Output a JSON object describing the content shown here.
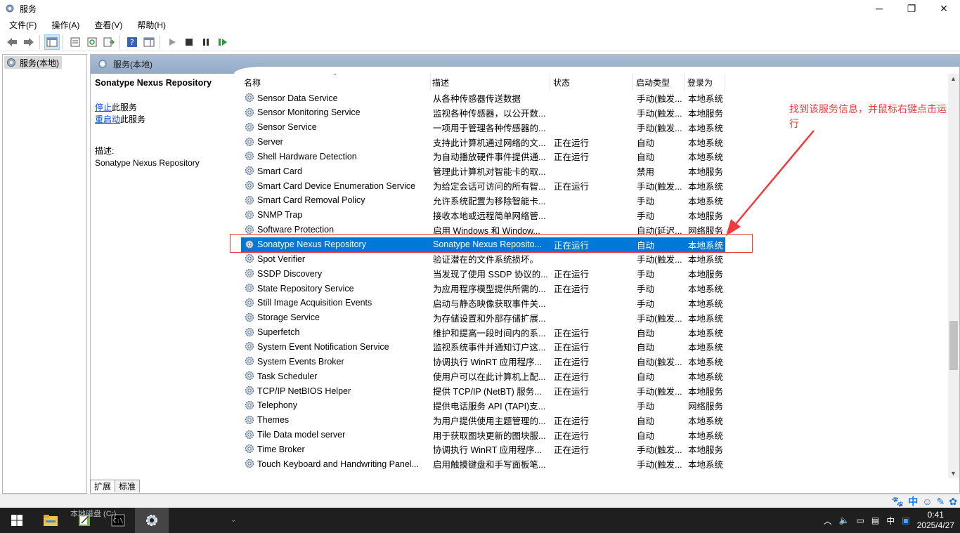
{
  "window": {
    "title": "服务",
    "minimize": "─",
    "maximize": "❐",
    "close": "✕"
  },
  "menu": [
    "文件(F)",
    "操作(A)",
    "查看(V)",
    "帮助(H)"
  ],
  "tree": {
    "root_label": "服务(本地)"
  },
  "panel": {
    "header": "服务(本地)"
  },
  "detail": {
    "title": "Sonatype Nexus Repository",
    "stop_link": "停止",
    "stop_suffix": "此服务",
    "restart_link": "重启动",
    "restart_suffix": "此服务",
    "desc_label": "描述:",
    "desc_text": "Sonatype Nexus Repository"
  },
  "columns": {
    "name": "名称",
    "desc": "描述",
    "status": "状态",
    "startup": "启动类型",
    "logon": "登录为",
    "sort_indicator": "⌃"
  },
  "rows": [
    {
      "name": "Sensor Data Service",
      "desc": "从各种传感器传送数据",
      "status": "",
      "startup": "手动(触发...",
      "logon": "本地系统"
    },
    {
      "name": "Sensor Monitoring Service",
      "desc": "监视各种传感器，以公开数...",
      "status": "",
      "startup": "手动(触发...",
      "logon": "本地服务"
    },
    {
      "name": "Sensor Service",
      "desc": "一项用于管理各种传感器的...",
      "status": "",
      "startup": "手动(触发...",
      "logon": "本地系统"
    },
    {
      "name": "Server",
      "desc": "支持此计算机通过网络的文...",
      "status": "正在运行",
      "startup": "自动",
      "logon": "本地系统"
    },
    {
      "name": "Shell Hardware Detection",
      "desc": "为自动播放硬件事件提供通...",
      "status": "正在运行",
      "startup": "自动",
      "logon": "本地系统"
    },
    {
      "name": "Smart Card",
      "desc": "管理此计算机对智能卡的取...",
      "status": "",
      "startup": "禁用",
      "logon": "本地服务"
    },
    {
      "name": "Smart Card Device Enumeration Service",
      "desc": "为给定会话可访问的所有智...",
      "status": "正在运行",
      "startup": "手动(触发...",
      "logon": "本地系统"
    },
    {
      "name": "Smart Card Removal Policy",
      "desc": "允许系统配置为移除智能卡...",
      "status": "",
      "startup": "手动",
      "logon": "本地系统"
    },
    {
      "name": "SNMP Trap",
      "desc": "接收本地或远程简单网络管...",
      "status": "",
      "startup": "手动",
      "logon": "本地服务"
    },
    {
      "name": "Software Protection",
      "desc": "启用 Windows 和 Window...",
      "status": "",
      "startup": "自动(延迟...",
      "logon": "网络服务"
    },
    {
      "name": "Sonatype Nexus Repository",
      "desc": "Sonatype Nexus Reposito...",
      "status": "正在运行",
      "startup": "自动",
      "logon": "本地系统",
      "selected": true
    },
    {
      "name": "Spot Verifier",
      "desc": "验证潜在的文件系统损坏。",
      "status": "",
      "startup": "手动(触发...",
      "logon": "本地系统"
    },
    {
      "name": "SSDP Discovery",
      "desc": "当发现了使用 SSDP 协议的...",
      "status": "正在运行",
      "startup": "手动",
      "logon": "本地服务"
    },
    {
      "name": "State Repository Service",
      "desc": "为应用程序模型提供所需的...",
      "status": "正在运行",
      "startup": "手动",
      "logon": "本地系统"
    },
    {
      "name": "Still Image Acquisition Events",
      "desc": "启动与静态映像获取事件关...",
      "status": "",
      "startup": "手动",
      "logon": "本地系统"
    },
    {
      "name": "Storage Service",
      "desc": "为存储设置和外部存储扩展...",
      "status": "",
      "startup": "手动(触发...",
      "logon": "本地系统"
    },
    {
      "name": "Superfetch",
      "desc": "维护和提高一段时间内的系...",
      "status": "正在运行",
      "startup": "自动",
      "logon": "本地系统"
    },
    {
      "name": "System Event Notification Service",
      "desc": "监视系统事件并通知订户这...",
      "status": "正在运行",
      "startup": "自动",
      "logon": "本地系统"
    },
    {
      "name": "System Events Broker",
      "desc": "协调执行 WinRT 应用程序...",
      "status": "正在运行",
      "startup": "自动(触发...",
      "logon": "本地系统"
    },
    {
      "name": "Task Scheduler",
      "desc": "使用户可以在此计算机上配...",
      "status": "正在运行",
      "startup": "自动",
      "logon": "本地系统"
    },
    {
      "name": "TCP/IP NetBIOS Helper",
      "desc": "提供 TCP/IP (NetBT) 服务...",
      "status": "正在运行",
      "startup": "手动(触发...",
      "logon": "本地服务"
    },
    {
      "name": "Telephony",
      "desc": "提供电话服务 API (TAPI)支...",
      "status": "",
      "startup": "手动",
      "logon": "网络服务"
    },
    {
      "name": "Themes",
      "desc": "为用户提供使用主题管理的...",
      "status": "正在运行",
      "startup": "自动",
      "logon": "本地系统"
    },
    {
      "name": "Tile Data model server",
      "desc": "用于获取图块更新的图块服...",
      "status": "正在运行",
      "startup": "自动",
      "logon": "本地系统"
    },
    {
      "name": "Time Broker",
      "desc": "协调执行 WinRT 应用程序...",
      "status": "正在运行",
      "startup": "手动(触发...",
      "logon": "本地服务"
    },
    {
      "name": "Touch Keyboard and Handwriting Panel...",
      "desc": "启用触摸键盘和手写面板笔...",
      "status": "",
      "startup": "手动(触发...",
      "logon": "本地系统"
    }
  ],
  "tabs": [
    "扩展",
    "标准"
  ],
  "annotation": {
    "text": "找到该服务信息，并鼠标右键点击运行"
  },
  "ime": {
    "mode": "中"
  },
  "taskbar": {
    "behind_text": "本地磁盘 (C:)",
    "tray_lang": "中",
    "clock_time": "0:41",
    "clock_date": "2025/4/27"
  },
  "colors": {
    "selection": "#0078d7",
    "annotation": "#f23a3a",
    "header": "#a9bdd4"
  }
}
